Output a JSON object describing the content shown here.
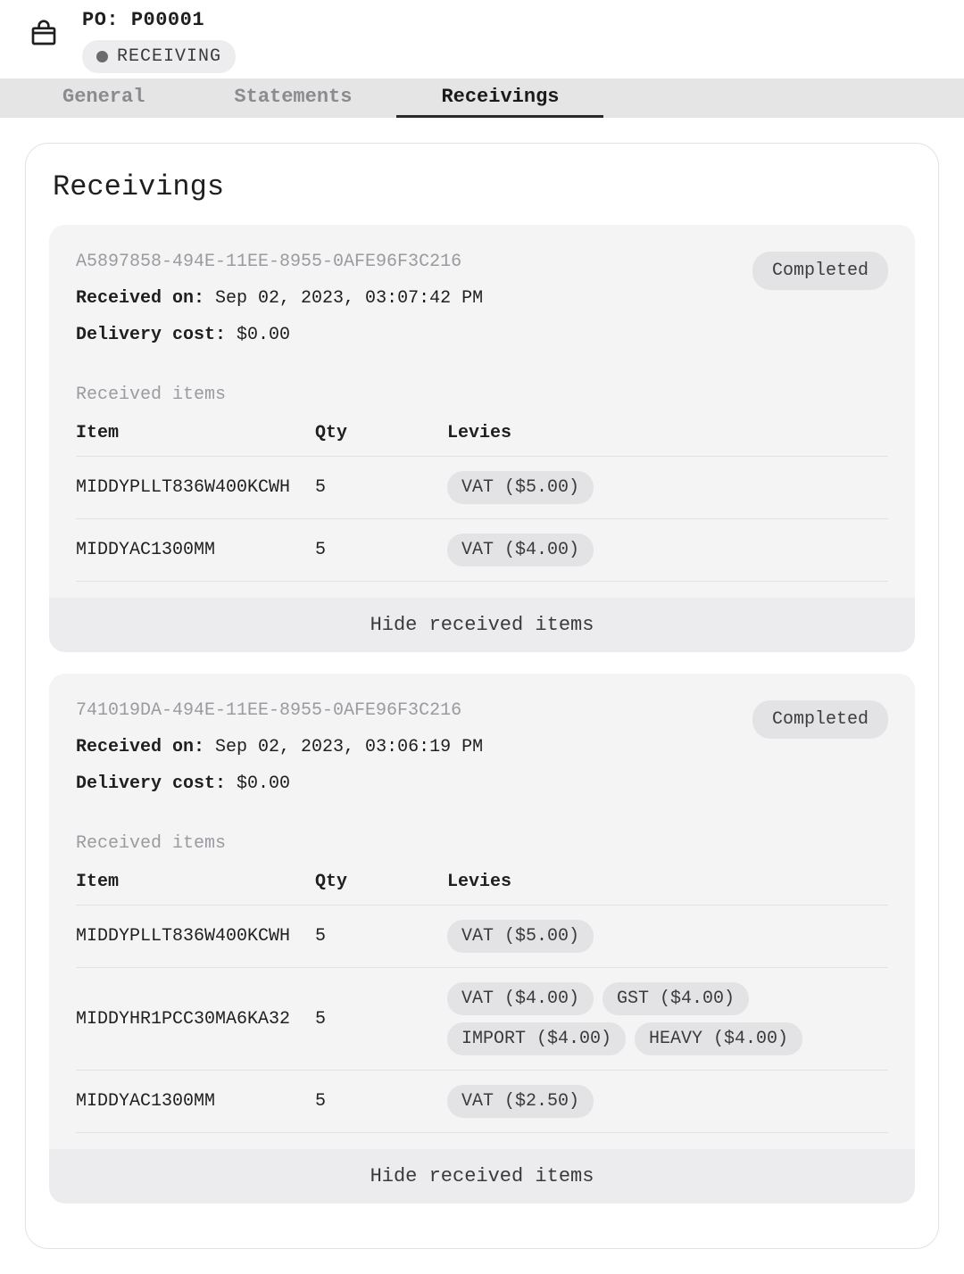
{
  "header": {
    "title_prefix": "PO:",
    "po_number": "P00001",
    "status_label": "RECEIVING",
    "tabs": [
      "General",
      "Statements",
      "Receivings"
    ],
    "active_tab_index": 2
  },
  "panel": {
    "title": "Receivings"
  },
  "table_headers": {
    "item": "Item",
    "qty": "Qty",
    "levies": "Levies"
  },
  "labels": {
    "received_on": "Received on:",
    "delivery_cost": "Delivery cost:",
    "received_items": "Received items",
    "hide_items": "Hide received items"
  },
  "receivings": [
    {
      "uuid": "A5897858-494E-11EE-8955-0AFE96F3C216",
      "status": "Completed",
      "received_on": "Sep 02, 2023, 03:07:42 PM",
      "delivery_cost": "$0.00",
      "items": [
        {
          "sku": "MIDDYPLLT836W400KCWH",
          "qty": "5",
          "levies": [
            "VAT ($5.00)"
          ]
        },
        {
          "sku": "MIDDYAC1300MM",
          "qty": "5",
          "levies": [
            "VAT ($4.00)"
          ]
        }
      ]
    },
    {
      "uuid": "741019DA-494E-11EE-8955-0AFE96F3C216",
      "status": "Completed",
      "received_on": "Sep 02, 2023, 03:06:19 PM",
      "delivery_cost": "$0.00",
      "items": [
        {
          "sku": "MIDDYPLLT836W400KCWH",
          "qty": "5",
          "levies": [
            "VAT ($5.00)"
          ]
        },
        {
          "sku": "MIDDYHR1PCC30MA6KA32",
          "qty": "5",
          "levies": [
            "VAT ($4.00)",
            "GST ($4.00)",
            "IMPORT ($4.00)",
            "HEAVY ($4.00)"
          ]
        },
        {
          "sku": "MIDDYAC1300MM",
          "qty": "5",
          "levies": [
            "VAT ($2.50)"
          ]
        }
      ]
    }
  ]
}
